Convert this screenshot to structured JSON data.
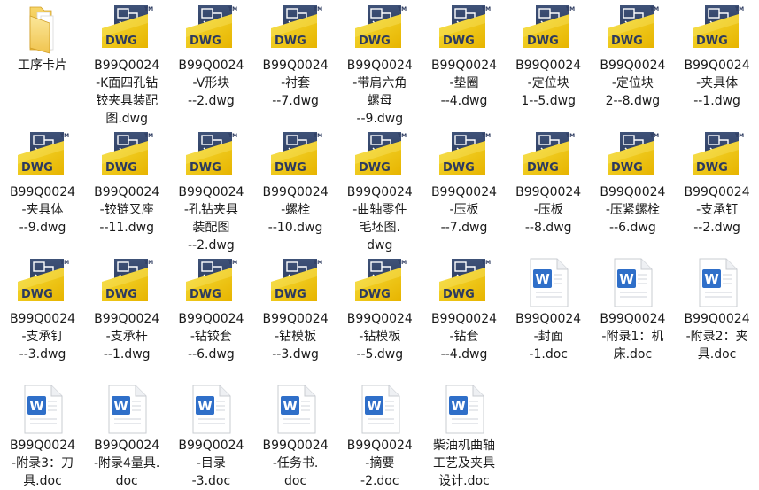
{
  "files": [
    {
      "name": "工序卡片",
      "type": "folder",
      "lines": [
        "工序卡片"
      ]
    },
    {
      "name": "B99Q0024-K面四孔钻铰夹具装配图.dwg",
      "type": "dwg",
      "lines": [
        "B99Q0024",
        "-K面四孔钻",
        "铰夹具装配",
        "图.dwg"
      ]
    },
    {
      "name": "B99Q0024-V形块--2.dwg",
      "type": "dwg",
      "lines": [
        "B99Q0024",
        "-V形块",
        "--2.dwg"
      ]
    },
    {
      "name": "B99Q0024-衬套--7.dwg",
      "type": "dwg",
      "lines": [
        "B99Q0024",
        "-衬套",
        "--7.dwg"
      ]
    },
    {
      "name": "B99Q0024-带肩六角螺母--9.dwg",
      "type": "dwg",
      "lines": [
        "B99Q0024",
        "-带肩六角",
        "螺母",
        "--9.dwg"
      ]
    },
    {
      "name": "B99Q0024-垫圈--4.dwg",
      "type": "dwg",
      "lines": [
        "B99Q0024",
        "-垫圈",
        "--4.dwg"
      ]
    },
    {
      "name": "B99Q0024-定位块1--5.dwg",
      "type": "dwg",
      "lines": [
        "B99Q0024",
        "-定位块",
        "1--5.dwg"
      ]
    },
    {
      "name": "B99Q0024-定位块2--8.dwg",
      "type": "dwg",
      "lines": [
        "B99Q0024",
        "-定位块",
        "2--8.dwg"
      ]
    },
    {
      "name": "B99Q0024-夹具体--1.dwg",
      "type": "dwg",
      "lines": [
        "B99Q0024",
        "-夹具体",
        "--1.dwg"
      ]
    },
    {
      "name": "B99Q0024-夹具体--9.dwg",
      "type": "dwg",
      "lines": [
        "B99Q0024",
        "-夹具体",
        "--9.dwg"
      ]
    },
    {
      "name": "B99Q0024-铰链叉座--11.dwg",
      "type": "dwg",
      "lines": [
        "B99Q0024",
        "-铰链叉座",
        "--11.dwg"
      ]
    },
    {
      "name": "B99Q0024-孔钻夹具装配图--2.dwg",
      "type": "dwg",
      "lines": [
        "B99Q0024",
        "-孔钻夹具",
        "装配图",
        "--2.dwg"
      ]
    },
    {
      "name": "B99Q0024-螺栓--10.dwg",
      "type": "dwg",
      "lines": [
        "B99Q0024",
        "-螺栓",
        "--10.dwg"
      ]
    },
    {
      "name": "B99Q0024-曲轴零件毛坯图.dwg",
      "type": "dwg",
      "lines": [
        "B99Q0024",
        "-曲轴零件",
        "毛坯图.",
        "dwg"
      ]
    },
    {
      "name": "B99Q0024-压板--7.dwg",
      "type": "dwg",
      "lines": [
        "B99Q0024",
        "-压板",
        "--7.dwg"
      ]
    },
    {
      "name": "B99Q0024-压板--8.dwg",
      "type": "dwg",
      "lines": [
        "B99Q0024",
        "-压板",
        "--8.dwg"
      ]
    },
    {
      "name": "B99Q0024-压紧螺栓--6.dwg",
      "type": "dwg",
      "lines": [
        "B99Q0024",
        "-压紧螺栓",
        "--6.dwg"
      ]
    },
    {
      "name": "B99Q0024-支承钉--2.dwg",
      "type": "dwg",
      "lines": [
        "B99Q0024",
        "-支承钉",
        "--2.dwg"
      ]
    },
    {
      "name": "B99Q0024-支承钉--3.dwg",
      "type": "dwg",
      "lines": [
        "B99Q0024",
        "-支承钉",
        "--3.dwg"
      ]
    },
    {
      "name": "B99Q0024-支承杆--1.dwg",
      "type": "dwg",
      "lines": [
        "B99Q0024",
        "-支承杆",
        "--1.dwg"
      ]
    },
    {
      "name": "B99Q0024-钻铰套--6.dwg",
      "type": "dwg",
      "lines": [
        "B99Q0024",
        "-钻铰套",
        "--6.dwg"
      ]
    },
    {
      "name": "B99Q0024-钻模板--3.dwg",
      "type": "dwg",
      "lines": [
        "B99Q0024",
        "-钻模板",
        "--3.dwg"
      ]
    },
    {
      "name": "B99Q0024-钻模板--5.dwg",
      "type": "dwg",
      "lines": [
        "B99Q0024",
        "-钻模板",
        "--5.dwg"
      ]
    },
    {
      "name": "B99Q0024-钻套--4.dwg",
      "type": "dwg",
      "lines": [
        "B99Q0024",
        "-钻套",
        "--4.dwg"
      ]
    },
    {
      "name": "B99Q0024-封面-1.doc",
      "type": "doc",
      "lines": [
        "B99Q0024",
        "-封面",
        "-1.doc"
      ]
    },
    {
      "name": "B99Q0024-附录1：机床.doc",
      "type": "doc",
      "lines": [
        "B99Q0024",
        "-附录1：机",
        "床.doc"
      ]
    },
    {
      "name": "B99Q0024-附录2：夹具.doc",
      "type": "doc",
      "lines": [
        "B99Q0024",
        "-附录2：夹",
        "具.doc"
      ]
    },
    {
      "name": "B99Q0024-附录3：刀具.doc",
      "type": "doc",
      "lines": [
        "B99Q0024",
        "-附录3：刀",
        "具.doc"
      ]
    },
    {
      "name": "B99Q0024-附录4量具.doc",
      "type": "doc",
      "lines": [
        "B99Q0024",
        "-附录4量具.",
        "doc"
      ]
    },
    {
      "name": "B99Q0024-目录-3.doc",
      "type": "doc",
      "lines": [
        "B99Q0024",
        "-目录",
        "-3.doc"
      ]
    },
    {
      "name": "B99Q0024-任务书.doc",
      "type": "doc",
      "lines": [
        "B99Q0024",
        "-任务书.",
        "doc"
      ]
    },
    {
      "name": "B99Q0024-摘要-2.doc",
      "type": "doc",
      "lines": [
        "B99Q0024",
        "-摘要",
        "-2.doc"
      ]
    },
    {
      "name": "柴油机曲轴工艺及夹具设计.doc",
      "type": "doc",
      "lines": [
        "柴油机曲轴",
        "工艺及夹具",
        "设计.doc"
      ]
    }
  ],
  "icons": {
    "dwg_badge": "DWG",
    "dwg_tm": "TM",
    "doc_letter": "W"
  }
}
